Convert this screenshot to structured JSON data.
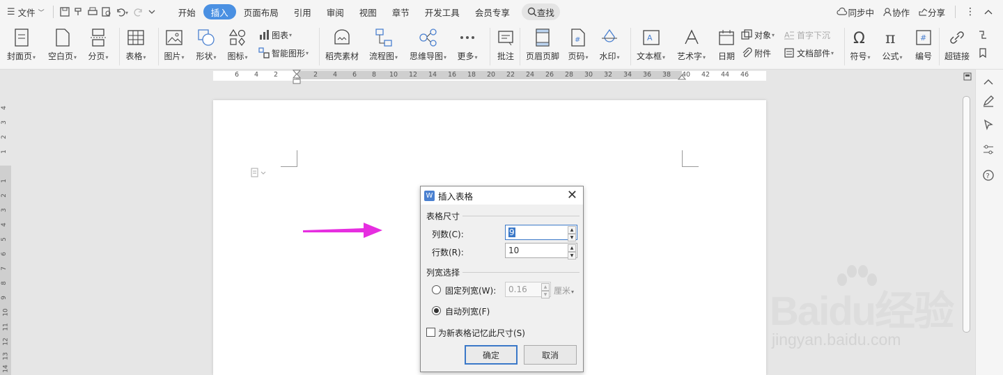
{
  "menubar": {
    "file_label": "文件",
    "tabs": [
      "开始",
      "插入",
      "页面布局",
      "引用",
      "审阅",
      "视图",
      "章节",
      "开发工具",
      "会员专享"
    ],
    "active_tab": "插入",
    "search_label": "查找",
    "right": {
      "sync": "同步中",
      "collab": "协作",
      "share": "分享"
    }
  },
  "ribbon": {
    "cover": "封面页",
    "blank": "空白页",
    "pagebreak": "分页",
    "table": "表格",
    "picture": "图片",
    "shape": "形状",
    "icon": "图标",
    "chart": "图表",
    "smartart": "智能图形",
    "material": "稻壳素材",
    "flowchart": "流程图",
    "mindmap": "思维导图",
    "more": "更多",
    "comment": "批注",
    "header_footer": "页眉页脚",
    "page_number": "页码",
    "watermark": "水印",
    "textbox": "文本框",
    "wordart": "艺术字",
    "date": "日期",
    "object": "对象",
    "dropcap": "首字下沉",
    "attachment": "附件",
    "doc_parts": "文档部件",
    "symbol": "符号",
    "formula": "公式",
    "numbering": "编号",
    "hyperlink": "超链接"
  },
  "ruler": {
    "ticks_left": [
      "6",
      "4",
      "2"
    ],
    "ticks_main": [
      "2",
      "4",
      "6",
      "8",
      "10",
      "12",
      "14",
      "16",
      "18",
      "20",
      "22",
      "24",
      "26",
      "28",
      "30",
      "32",
      "34",
      "36",
      "38",
      "40",
      "42",
      "44",
      "46"
    ],
    "ticks_vertical": [
      "4",
      "3",
      "2",
      "1",
      "1",
      "2",
      "3",
      "4",
      "5",
      "6",
      "7",
      "8",
      "9",
      "10",
      "11",
      "12",
      "13",
      "14"
    ]
  },
  "dialog": {
    "title": "插入表格",
    "size_group": "表格尺寸",
    "columns_label": "列数(C):",
    "columns_value": "9",
    "rows_label": "行数(R):",
    "rows_value": "10",
    "width_group": "列宽选择",
    "fixed_label": "固定列宽(W):",
    "fixed_value": "0.16",
    "fixed_unit": "厘米",
    "auto_label": "自动列宽(F)",
    "remember_label": "为新表格记忆此尺寸(S)",
    "ok": "确定",
    "cancel": "取消"
  },
  "colors": {
    "accent": "#4a90e2",
    "arrow": "#e62ee0"
  },
  "watermark": {
    "brand": "Baidu经验",
    "url": "jingyan.baidu.com"
  }
}
